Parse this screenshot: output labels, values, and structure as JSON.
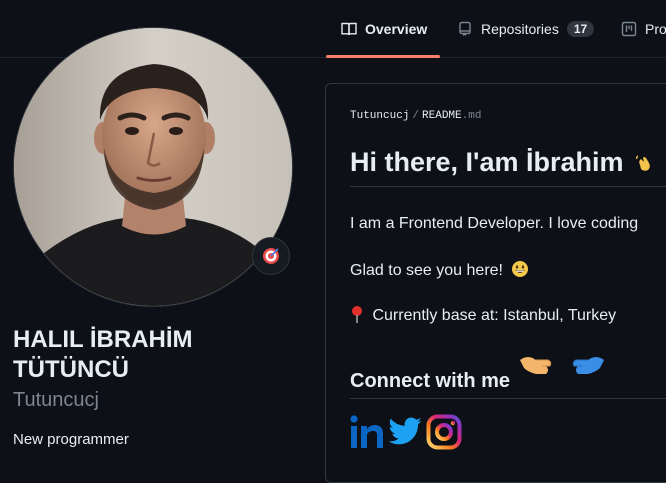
{
  "tabs": [
    {
      "label": "Overview",
      "icon": "book-icon",
      "active": true
    },
    {
      "label": "Repositories",
      "icon": "repo-icon",
      "count": "17"
    },
    {
      "label": "Projects",
      "icon": "project-icon"
    }
  ],
  "profile": {
    "full_name": "HALIL İBRAHİM TÜTÜNCÜ",
    "username": "Tutuncucj",
    "bio": "New programmer",
    "status_icon": "target-icon"
  },
  "readme": {
    "owner": "Tutuncucj",
    "separator": "/",
    "file": "README",
    "ext": ".md",
    "heading": "Hi there, I'am İbrahim",
    "intro": "I am a Frontend Developer. I love coding",
    "glad": "Glad to see you here!",
    "location": "Currently base at: Istanbul, Turkey",
    "connect": "Connect with me",
    "socials": [
      "linkedin-icon",
      "twitter-icon",
      "instagram-icon"
    ]
  },
  "colors": {
    "background": "#0d1117",
    "accent_underline": "#f78166",
    "muted_text": "#7d8590",
    "linkedin": "#0a66c2",
    "twitter": "#1da1f2"
  }
}
